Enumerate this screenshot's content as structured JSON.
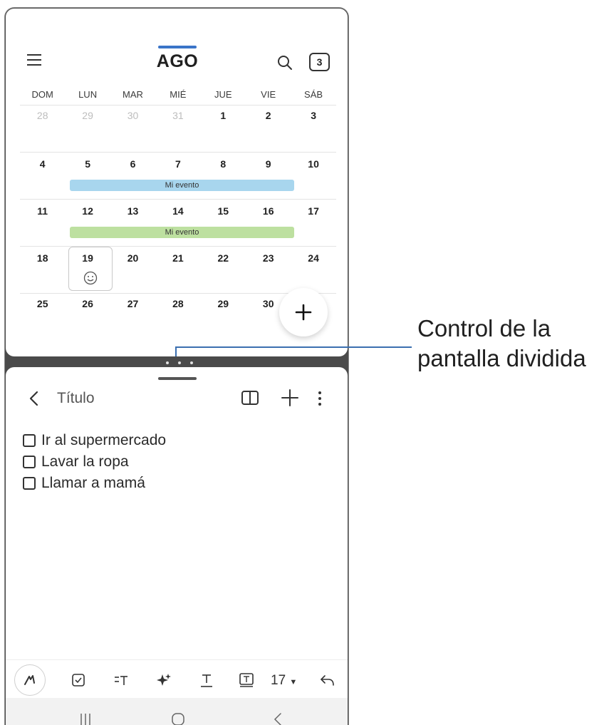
{
  "calendar": {
    "month": "AGO",
    "today_badge": "3",
    "weekdays": [
      "DOM",
      "LUN",
      "MAR",
      "MIÉ",
      "JUE",
      "VIE",
      "SÁB"
    ],
    "weeks": [
      [
        "28",
        "29",
        "30",
        "31",
        "1",
        "2",
        "3"
      ],
      [
        "4",
        "5",
        "6",
        "7",
        "8",
        "9",
        "10"
      ],
      [
        "11",
        "12",
        "13",
        "14",
        "15",
        "16",
        "17"
      ],
      [
        "18",
        "19",
        "20",
        "21",
        "22",
        "23",
        "24"
      ],
      [
        "25",
        "26",
        "27",
        "28",
        "29",
        "30",
        ""
      ]
    ],
    "events": [
      "Mi evento",
      "Mi evento"
    ]
  },
  "callout": {
    "line1": "Control de la",
    "line2": "pantalla dividida"
  },
  "notes": {
    "title": "Título",
    "items": [
      "Ir al supermercado",
      "Lavar la ropa",
      "Llamar a mamá"
    ],
    "font_size": "17"
  },
  "colors": {
    "accent": "#3a74c8",
    "event_blue": "#a8d6ee",
    "event_green": "#bde0a0",
    "callout_line": "#3b6fb0"
  }
}
